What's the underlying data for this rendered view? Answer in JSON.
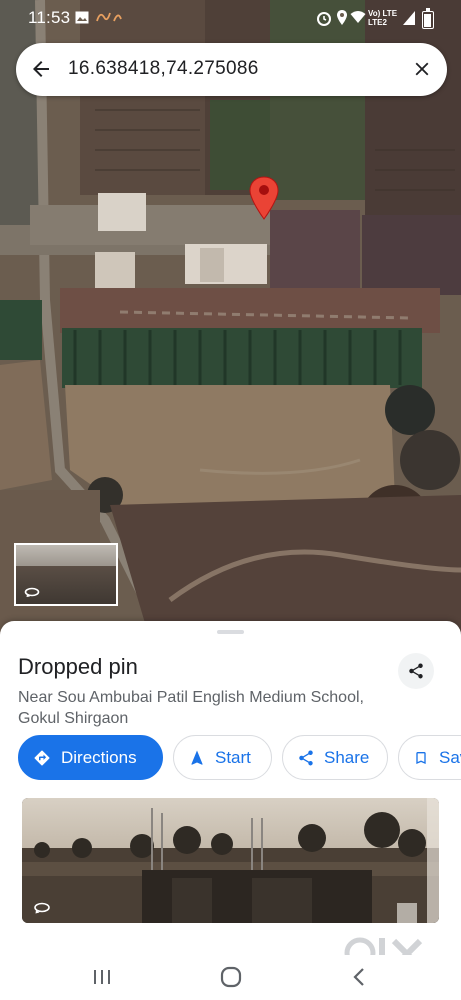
{
  "status_bar": {
    "time": "11:53",
    "network_line1": "Vo) LTE",
    "network_line2": "LTE2",
    "icons": [
      "gallery-icon",
      "app-notification-icon",
      "alarm-icon",
      "location-icon",
      "wifi-icon",
      "signal-icon",
      "battery-icon"
    ]
  },
  "search": {
    "query": "16.638418,74.275086",
    "back_icon": "arrow-back-icon",
    "clear_icon": "close-icon"
  },
  "map": {
    "type": "satellite",
    "pin_color": "#ea4335",
    "pin_icon": "map-pin-icon"
  },
  "place": {
    "title": "Dropped pin",
    "address": "Near Sou Ambubai Patil English Medium School, Gokul Shirgaon"
  },
  "actions": [
    {
      "label": "Directions",
      "icon": "directions-icon"
    },
    {
      "label": "Start",
      "icon": "navigation-arrow-icon"
    },
    {
      "label": "Share",
      "icon": "share-icon"
    },
    {
      "label": "Save",
      "icon": "bookmark-icon"
    }
  ],
  "watermark": "OLX",
  "colors": {
    "accent": "#1a73e8",
    "text_primary": "#202124",
    "text_secondary": "#5f6368"
  }
}
